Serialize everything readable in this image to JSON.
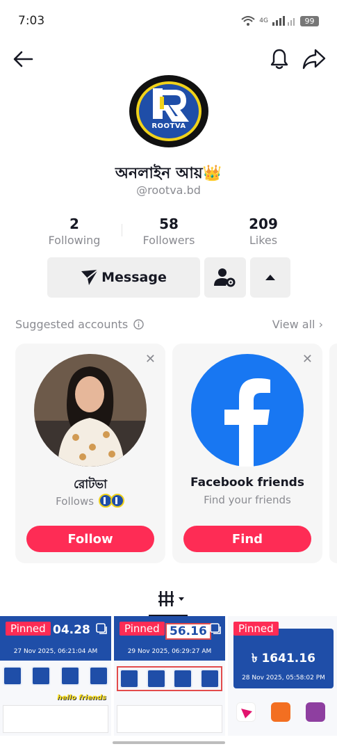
{
  "status_bar": {
    "time": "7:03",
    "network": "4G",
    "battery": "99"
  },
  "profile": {
    "logo_text": "ROOTVA",
    "name": "অনলাইন আয়👑",
    "handle": "@rootva.bd",
    "stats": [
      {
        "value": "2",
        "label": "Following"
      },
      {
        "value": "58",
        "label": "Followers"
      },
      {
        "value": "209",
        "label": "Likes"
      }
    ],
    "message_label": "Message"
  },
  "suggested": {
    "title": "Suggested accounts",
    "view_all": "View all",
    "cards": [
      {
        "name": "রোটভা",
        "sub": "Follows",
        "button": "Follow"
      },
      {
        "name": "Facebook friends",
        "sub": "Find your friends",
        "button": "Find"
      }
    ]
  },
  "videos": [
    {
      "pinned": "Pinned",
      "amount": "04.28",
      "date": "27 Nov 2025, 06:21:04 AM",
      "sticker": "hello friends"
    },
    {
      "pinned": "Pinned",
      "amount": "56.16",
      "date": "29 Nov 2025, 06:29:27 AM"
    },
    {
      "pinned": "Pinned",
      "amount": "৳ 1641.16",
      "date": "28 Nov 2025, 05:58:02 PM"
    }
  ],
  "colors": {
    "accent": "#fe2c55",
    "brand_blue": "#1f4ea8",
    "logo_yellow": "#f0d21a",
    "facebook_blue": "#1877f2"
  }
}
